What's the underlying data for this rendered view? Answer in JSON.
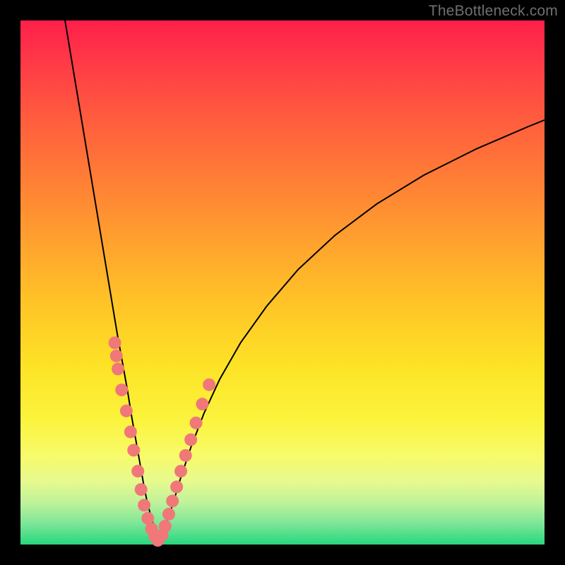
{
  "watermark": "TheBottleneck.com",
  "chart_data": {
    "type": "line",
    "title": "",
    "xlabel": "",
    "ylabel": "",
    "xlim": [
      0,
      100
    ],
    "ylim": [
      0,
      100
    ],
    "curve_left": {
      "x": [
        8.5,
        10.0,
        11.5,
        13.0,
        14.5,
        16.0,
        17.5,
        18.5,
        19.5,
        20.4,
        21.2,
        22.0,
        22.8,
        23.5,
        24.2,
        25.0,
        25.8,
        26.5
      ],
      "y": [
        100.0,
        91.0,
        82.0,
        73.0,
        64.0,
        55.0,
        46.0,
        40.0,
        34.5,
        29.5,
        24.5,
        20.0,
        15.5,
        11.5,
        8.0,
        5.0,
        2.5,
        0.8
      ]
    },
    "curve_right": {
      "x": [
        26.5,
        27.5,
        29.0,
        30.5,
        32.5,
        35.0,
        38.0,
        42.0,
        47.0,
        53.0,
        60.0,
        68.0,
        77.0,
        87.0,
        97.0,
        100.0
      ],
      "y": [
        0.8,
        3.0,
        7.5,
        12.5,
        18.5,
        25.0,
        31.5,
        38.5,
        45.5,
        52.5,
        59.0,
        65.0,
        70.5,
        75.5,
        79.8,
        81.0
      ]
    },
    "series": [
      {
        "name": "left-cluster-dots",
        "x": [
          18.0,
          18.3,
          18.6,
          19.3,
          20.2,
          21.0,
          21.6,
          22.4,
          23.0,
          23.6,
          24.3,
          25.0,
          25.6,
          26.2
        ],
        "y": [
          38.5,
          36.0,
          33.5,
          29.5,
          25.5,
          21.5,
          18.0,
          14.0,
          10.5,
          7.5,
          5.0,
          3.0,
          1.6,
          0.8
        ]
      },
      {
        "name": "right-cluster-dots",
        "x": [
          27.0,
          27.6,
          28.3,
          29.0,
          29.8,
          30.6,
          31.5,
          32.5,
          33.5,
          34.7,
          36.0
        ],
        "y": [
          1.8,
          3.5,
          5.8,
          8.3,
          11.0,
          14.0,
          17.0,
          20.0,
          23.2,
          26.8,
          30.5
        ]
      }
    ],
    "dot_color": "#f07878",
    "dot_radius_px": 9
  }
}
